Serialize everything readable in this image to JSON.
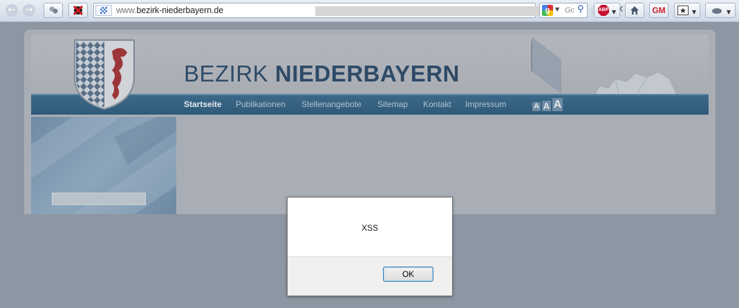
{
  "browser": {
    "url_prefix": "www.",
    "url_domain": "bezirk-niederbayern.de",
    "search_placeholder": "Gc",
    "abp_label": "ABP",
    "gm_label": "GM"
  },
  "site": {
    "title_light": "BEZIRK ",
    "title_bold": "NIEDERBAYERN",
    "nav": [
      {
        "label": "Startseite",
        "active": true
      },
      {
        "label": "Publikationen"
      },
      {
        "label": "Stellenangebote"
      },
      {
        "label": "Sitemap"
      },
      {
        "label": "Kontakt"
      },
      {
        "label": "Impressum"
      }
    ],
    "font_sizer": [
      "A",
      "A",
      "A"
    ]
  },
  "dialog": {
    "message": "XSS",
    "ok_label": "OK"
  },
  "colors": {
    "nav_strip": "#2f5a79",
    "title": "#2e4a66",
    "overlay": "#8d96a3"
  }
}
